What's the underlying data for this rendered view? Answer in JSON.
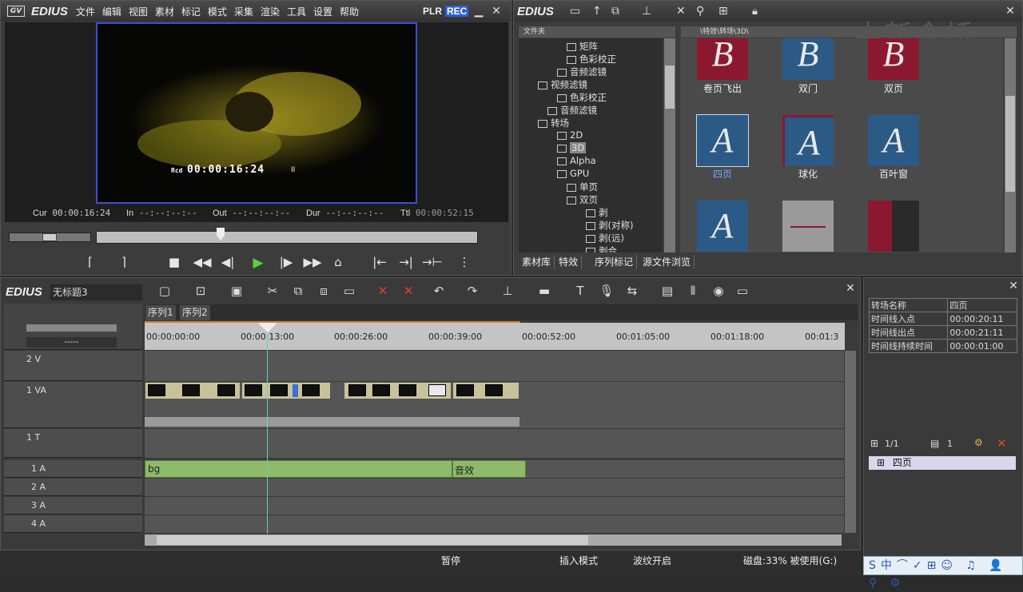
{
  "player": {
    "title": "EDIUS",
    "menu": [
      "文件",
      "编辑",
      "视图",
      "素材",
      "标记",
      "模式",
      "采集",
      "渲染",
      "工具",
      "设置",
      "帮助"
    ],
    "plr": "PLR",
    "rec": "REC",
    "overlay_timecode": "00:00:16:24",
    "overlay_rec": "Rcd",
    "cur_label": "Cur",
    "cur": "00:00:16:24",
    "in_label": "In",
    "in": "--:--:--:--",
    "out_label": "Out",
    "out": "--:--:--:--",
    "dur_label": "Dur",
    "dur": "--:--:--:--",
    "ttl_label": "Ttl",
    "ttl": "00:00:52:15"
  },
  "bin": {
    "title": "EDIUS",
    "watermark": "中新金桥",
    "tree_header": "文件夹",
    "path": "\\特效\\转场\\3D\\",
    "tree": [
      {
        "label": "矩阵",
        "indent": 5
      },
      {
        "label": "色彩校正",
        "indent": 5
      },
      {
        "label": "音频滤镜",
        "indent": 4
      },
      {
        "label": "视频滤镜",
        "indent": 2
      },
      {
        "label": "色彩校正",
        "indent": 4
      },
      {
        "label": "音频滤镜",
        "indent": 3
      },
      {
        "label": "转场",
        "indent": 2
      },
      {
        "label": "2D",
        "indent": 4
      },
      {
        "label": "3D",
        "indent": 4
      },
      {
        "label": "Alpha",
        "indent": 4
      },
      {
        "label": "GPU",
        "indent": 4
      },
      {
        "label": "单页",
        "indent": 5
      },
      {
        "label": "双页",
        "indent": 5
      },
      {
        "label": "剥",
        "indent": 7
      },
      {
        "label": "剥(对称)",
        "indent": 7
      },
      {
        "label": "剥(远)",
        "indent": 7
      },
      {
        "label": "剥合",
        "indent": 7
      }
    ],
    "items": [
      "卷页飞出",
      "双门",
      "双页",
      "四页",
      "球化",
      "百叶窗",
      "",
      "",
      ""
    ],
    "tabs": [
      "素材库",
      "特效",
      "序列标记",
      "源文件浏览"
    ]
  },
  "timeline": {
    "title": "EDIUS",
    "project": "无标题3",
    "seq_tabs": [
      "序列1",
      "序列2"
    ],
    "ruler": [
      "00:00:00:00",
      "00:00:13:00",
      "00:00:26:00",
      "00:00:39:00",
      "00:00:52:00",
      "00:01:05:00",
      "00:01:18:00",
      "00:01:3"
    ],
    "tracks": {
      "v2": "2 V",
      "va1": "1 VA",
      "t1": "1 T",
      "a1": "1 A",
      "a2": "2 A",
      "a3": "3 A",
      "a4": "4 A"
    },
    "audio_clips": [
      "bg",
      "音效"
    ],
    "dash": "-----"
  },
  "info": {
    "rows": [
      {
        "k": "转场名称",
        "v": "四页"
      },
      {
        "k": "时间线入点",
        "v": "00:00:20:11"
      },
      {
        "k": "时间线出点",
        "v": "00:00:21:11"
      },
      {
        "k": "时间线持续时间",
        "v": "00:00:01:00"
      }
    ],
    "page": "1/1",
    "count": "1",
    "list_item": "四页"
  },
  "status": {
    "state": "暂停",
    "mode": "插入模式",
    "ripple": "波纹开启",
    "disk": "磁盘:33% 被使用(G:)"
  }
}
